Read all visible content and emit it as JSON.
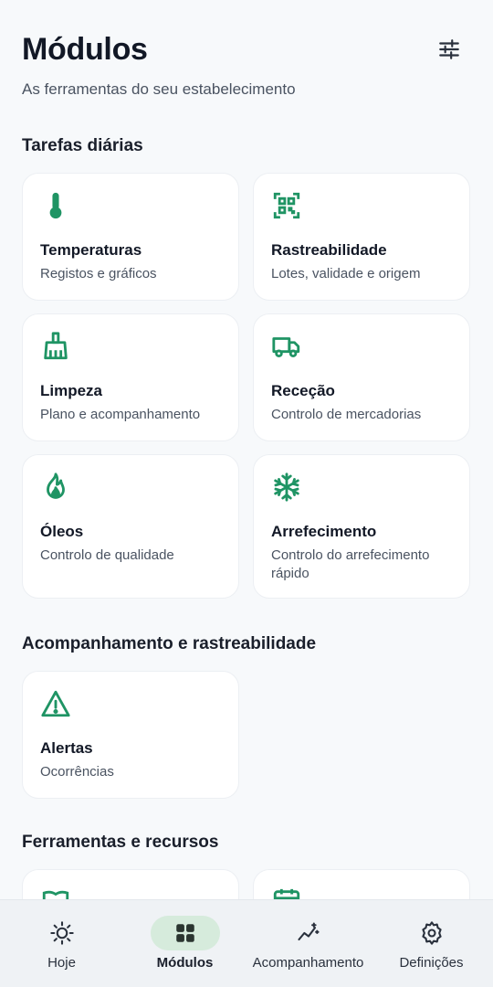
{
  "header": {
    "title": "Módulos",
    "subtitle": "As ferramentas do seu estabelecimento",
    "filter_icon": "sliders-icon"
  },
  "colors": {
    "accent": "#1f9464",
    "background": "#f7f9fb",
    "nav_active_pill": "#d6ebdc"
  },
  "sections": [
    {
      "title": "Tarefas diárias",
      "cards": [
        {
          "title": "Temperaturas",
          "description": "Registos e gráficos",
          "icon": "thermometer-icon"
        },
        {
          "title": "Rastreabilidade",
          "description": "Lotes, validade e origem",
          "icon": "qr-code-icon"
        },
        {
          "title": "Limpeza",
          "description": "Plano e acompanhamento",
          "icon": "broom-icon"
        },
        {
          "title": "Receção",
          "description": "Controlo de mercadorias",
          "icon": "truck-icon"
        },
        {
          "title": "Óleos",
          "description": "Controlo de qualidade",
          "icon": "flame-icon"
        },
        {
          "title": "Arrefecimento",
          "description": "Controlo do arrefecimento rápido",
          "icon": "snowflake-icon"
        }
      ]
    },
    {
      "title": "Acompanhamento e rastreabilidade",
      "cards": [
        {
          "title": "Alertas",
          "description": "Ocorrências",
          "icon": "warning-icon"
        }
      ]
    },
    {
      "title": "Ferramentas e recursos",
      "cards": [
        {
          "icon": "book-icon"
        },
        {
          "icon": "calendar-icon"
        }
      ]
    }
  ],
  "bottom_nav": {
    "items": [
      {
        "label": "Hoje",
        "icon": "sun-icon",
        "active": false
      },
      {
        "label": "Módulos",
        "icon": "grid-icon",
        "active": true
      },
      {
        "label": "Acompanhamento",
        "icon": "trend-icon",
        "active": false
      },
      {
        "label": "Definições",
        "icon": "gear-icon",
        "active": false
      }
    ]
  }
}
